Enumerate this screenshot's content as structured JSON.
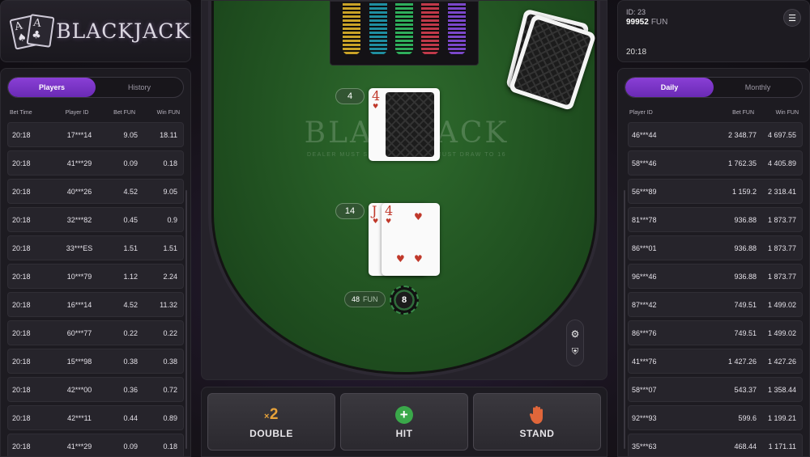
{
  "logo": {
    "title": "BLACKJACK"
  },
  "left_panel": {
    "tabs": [
      {
        "label": "Players",
        "active": true
      },
      {
        "label": "History",
        "active": false
      }
    ],
    "columns": [
      "Bet Time",
      "Player ID",
      "Bet  FUN",
      "Win  FUN"
    ],
    "rows": [
      {
        "time": "20:18",
        "player": "17***14",
        "bet": "9.05",
        "win": "18.11"
      },
      {
        "time": "20:18",
        "player": "41***29",
        "bet": "0.09",
        "win": "0.18"
      },
      {
        "time": "20:18",
        "player": "40***26",
        "bet": "4.52",
        "win": "9.05"
      },
      {
        "time": "20:18",
        "player": "32***82",
        "bet": "0.45",
        "win": "0.9"
      },
      {
        "time": "20:18",
        "player": "33***ES",
        "bet": "1.51",
        "win": "1.51"
      },
      {
        "time": "20:18",
        "player": "10***79",
        "bet": "1.12",
        "win": "2.24"
      },
      {
        "time": "20:18",
        "player": "16***14",
        "bet": "4.52",
        "win": "11.32"
      },
      {
        "time": "20:18",
        "player": "60***77",
        "bet": "0.22",
        "win": "0.22"
      },
      {
        "time": "20:18",
        "player": "15***98",
        "bet": "0.38",
        "win": "0.38"
      },
      {
        "time": "20:18",
        "player": "42***00",
        "bet": "0.36",
        "win": "0.72"
      },
      {
        "time": "20:18",
        "player": "42***11",
        "bet": "0.44",
        "win": "0.89"
      },
      {
        "time": "20:18",
        "player": "41***29",
        "bet": "0.09",
        "win": "0.18"
      }
    ]
  },
  "info": {
    "id": "ID: 23",
    "balance": "99952",
    "currency": "FUN",
    "time": "20:18",
    "menu_icon": "hamburger-icon"
  },
  "right_panel": {
    "tabs": [
      {
        "label": "Daily",
        "active": true
      },
      {
        "label": "Monthly",
        "active": false
      }
    ],
    "columns": [
      "Player ID",
      "Bet  FUN",
      "Win  FUN"
    ],
    "rows": [
      {
        "player": "46***44",
        "bet": "2 348.77",
        "win": "4 697.55"
      },
      {
        "player": "58***46",
        "bet": "1 762.35",
        "win": "4 405.89"
      },
      {
        "player": "56***89",
        "bet": "1 159.2",
        "win": "2 318.41"
      },
      {
        "player": "81***78",
        "bet": "936.88",
        "win": "1 873.77"
      },
      {
        "player": "86***01",
        "bet": "936.88",
        "win": "1 873.77"
      },
      {
        "player": "96***46",
        "bet": "936.88",
        "win": "1 873.77"
      },
      {
        "player": "87***42",
        "bet": "749.51",
        "win": "1 499.02"
      },
      {
        "player": "86***76",
        "bet": "749.51",
        "win": "1 499.02"
      },
      {
        "player": "41***76",
        "bet": "1 427.26",
        "win": "1 427.26"
      },
      {
        "player": "58***07",
        "bet": "543.37",
        "win": "1 358.44"
      },
      {
        "player": "92***93",
        "bet": "599.6",
        "win": "1 199.21"
      },
      {
        "player": "35***63",
        "bet": "468.44",
        "win": "1 171.11"
      }
    ]
  },
  "table": {
    "felt_title": "BLACKJACK",
    "felt_subtitle": "DEALER MUST STAND TO 17, AND MUST DRAW TO 16",
    "dealer": {
      "score": "4",
      "cards": [
        {
          "rank": "4",
          "suit": "♥"
        }
      ]
    },
    "player": {
      "score": "14",
      "cards": [
        {
          "rank": "J",
          "suit": "♥"
        },
        {
          "rank": "4",
          "suit": "♥"
        }
      ]
    },
    "bet": {
      "amount": "48",
      "currency": "FUN"
    },
    "chip_value": "8",
    "chip_rack_colors": [
      "#c9a227",
      "#1f8ea0",
      "#2fae5c",
      "#c0394a",
      "#7a47c9"
    ]
  },
  "actions": [
    {
      "label": "DOUBLE",
      "icon": "x2-icon",
      "badge": "x2"
    },
    {
      "label": "HIT",
      "icon": "plus-circle-icon"
    },
    {
      "label": "STAND",
      "icon": "hand-icon"
    }
  ]
}
